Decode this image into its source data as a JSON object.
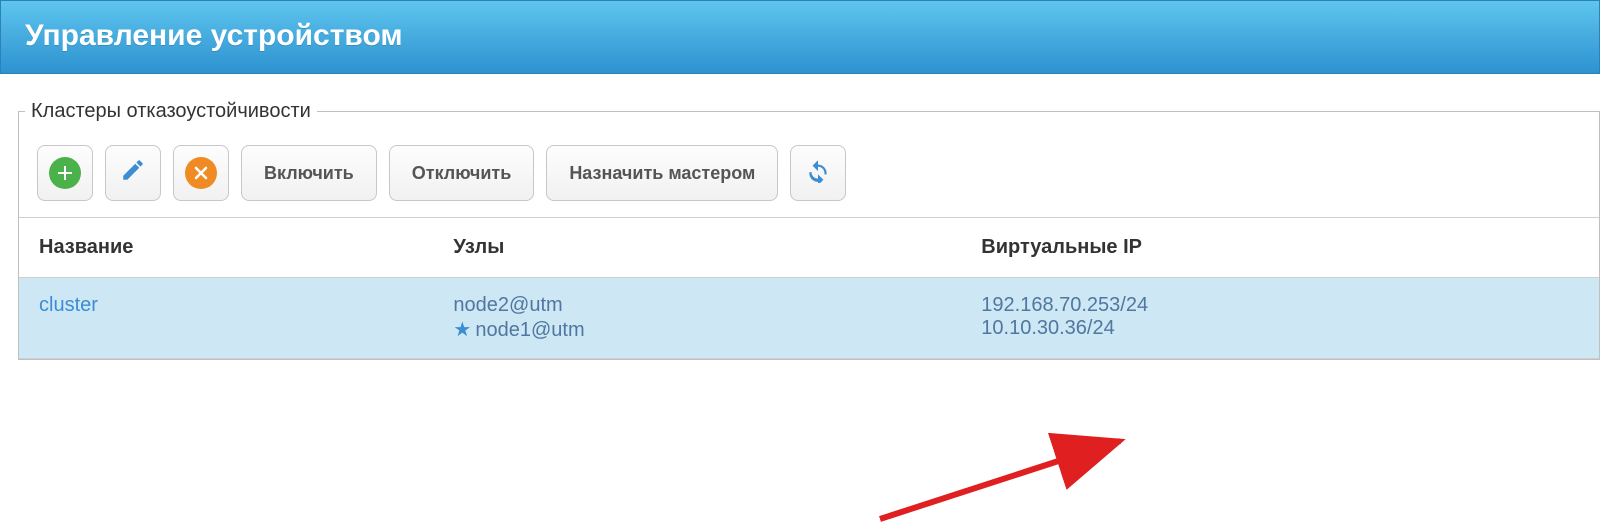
{
  "header": {
    "title": "Управление устройством"
  },
  "fieldset": {
    "legend": "Кластеры отказоустойчивости"
  },
  "toolbar": {
    "enable_label": "Включить",
    "disable_label": "Отключить",
    "assign_master_label": "Назначить мастером"
  },
  "table": {
    "headers": {
      "name": "Название",
      "nodes": "Узлы",
      "vips": "Виртуальные IP"
    },
    "rows": [
      {
        "name": "cluster",
        "node1": "node2@utm",
        "node2_master": "node1@utm",
        "vip1": "192.168.70.253/24",
        "vip2": "10.10.30.36/24"
      }
    ]
  }
}
